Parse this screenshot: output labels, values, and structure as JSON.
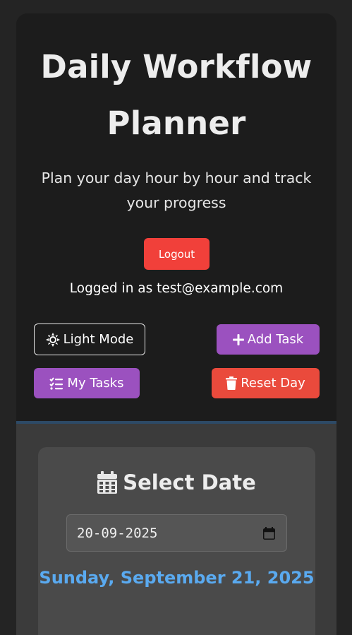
{
  "header": {
    "title": "Daily Workflow Planner",
    "subtitle": "Plan your day hour by hour and track your progress",
    "logout_label": "Logout",
    "logged_in_text": "Logged in as test@example.com"
  },
  "toolbar": {
    "light_mode_label": "Light Mode",
    "light_mode_icon": "sun-icon",
    "add_task_label": "Add Task",
    "add_task_icon": "plus-icon",
    "my_tasks_label": "My Tasks",
    "my_tasks_icon": "checklist-icon",
    "reset_day_label": "Reset Day",
    "reset_day_icon": "trash-icon"
  },
  "date_card": {
    "heading": "Select Date",
    "heading_icon": "calendar-icon",
    "date_value": "20-09-2025",
    "selected_date_text": "Sunday, September 21, 2025"
  },
  "colors": {
    "background": "#1b1b1b",
    "purple": "#9b51bf",
    "red": "#ea4a3c",
    "logout_red": "#f1403a",
    "date_blue": "#5aaaf0",
    "card": "#4a4a4a"
  }
}
